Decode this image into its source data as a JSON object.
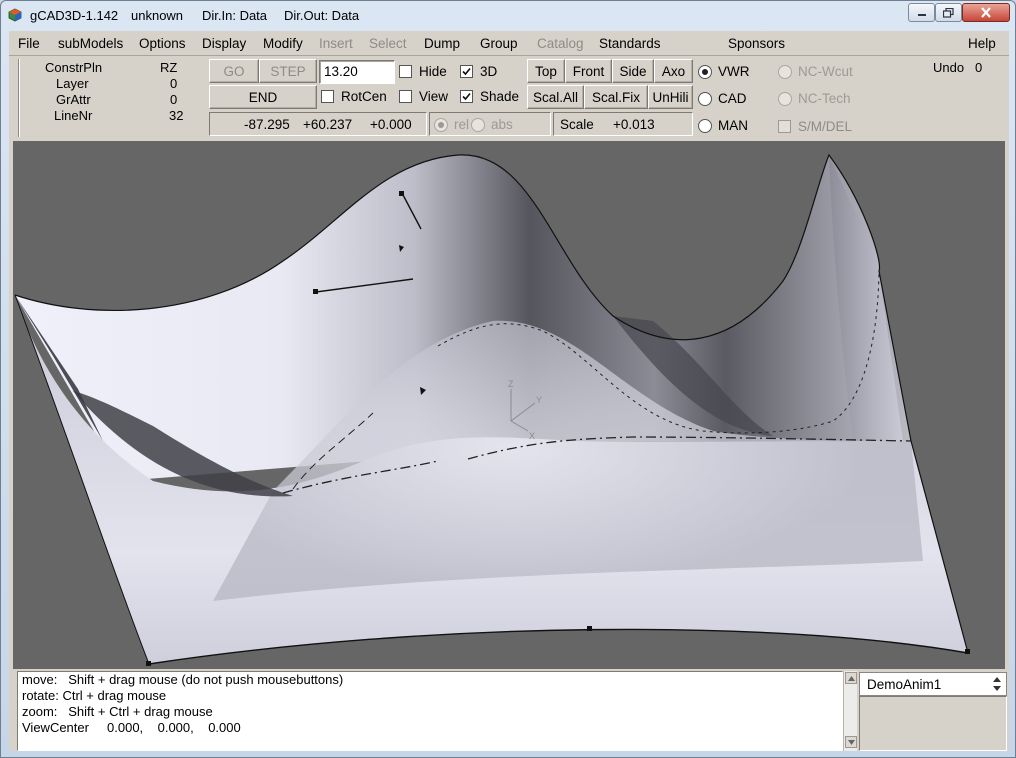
{
  "window": {
    "title": "gCAD3D-1.142",
    "model": "unknown",
    "dir_in": "Dir.In: Data",
    "dir_out": "Dir.Out: Data"
  },
  "menu": {
    "file": "File",
    "submodels": "subModels",
    "options": "Options",
    "display": "Display",
    "modify": "Modify",
    "insert": "Insert",
    "select": "Select",
    "dump": "Dump",
    "group": "Group",
    "catalog": "Catalog",
    "standards": "Standards",
    "sponsors": "Sponsors",
    "help": "Help"
  },
  "info": {
    "constrpln_label": "ConstrPln",
    "constrpln_value": "RZ",
    "layer_label": "Layer",
    "layer_value": "0",
    "grattr_label": "GrAttr",
    "grattr_value": "0",
    "linenr_label": "LineNr",
    "linenr_value": "32"
  },
  "controls": {
    "go": "GO",
    "step": "STEP",
    "end": "END",
    "entry_value": "13.20",
    "hide": "Hide",
    "three_d": "3D",
    "rotcen": "RotCen",
    "view": "View",
    "shade": "Shade",
    "top": "Top",
    "front": "Front",
    "side": "Side",
    "axo": "Axo",
    "scal_all": "Scal.All",
    "scal_fix": "Scal.Fix",
    "unhili": "UnHili",
    "coord_x": "-87.295",
    "coord_y": "+60.237",
    "coord_z": "+0.000",
    "rel": "rel",
    "abs": "abs",
    "scale_label": "Scale",
    "scale_value": "+0.013"
  },
  "modes": {
    "vwr": "VWR",
    "cad": "CAD",
    "man": "MAN",
    "nc_wcut": "NC-Wcut",
    "nc_tech": "NC-Tech",
    "smdel": "S/M/DEL",
    "undo_label": "Undo",
    "undo_value": "0"
  },
  "messages": [
    "move:   Shift + drag mouse (do not push mousebuttons)",
    "rotate: Ctrl + drag mouse",
    "zoom:   Shift + Ctrl + drag mouse",
    "ViewCenter     0.000,    0.000,    0.000"
  ],
  "combo": {
    "selected": "DemoAnim1"
  },
  "axis_labels": {
    "z": "Z",
    "y": "Y",
    "x": "X"
  },
  "colors": {
    "viewport_bg": "#666666",
    "panel_bg": "#d6d2ca",
    "surface_light": "#e8e8f4",
    "surface_dark": "#4a4a52"
  }
}
